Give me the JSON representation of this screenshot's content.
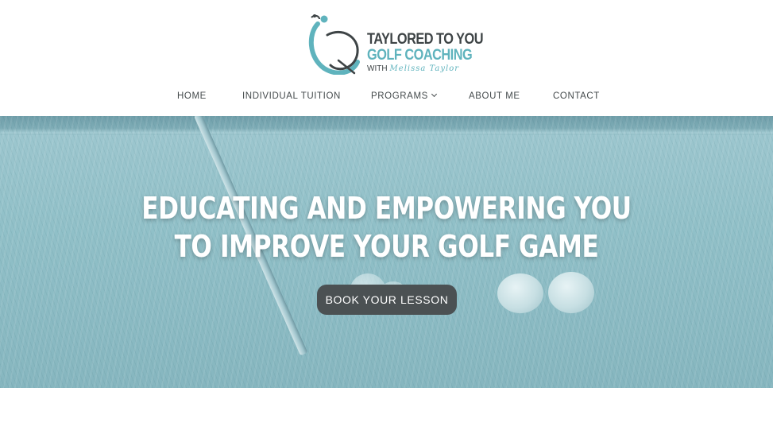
{
  "logo": {
    "line1": "TAYLORED TO YOU",
    "line2": "GOLF COACHING",
    "line3_prefix": "WITH",
    "line3_script": "Melissa Taylor",
    "icon": "golfer-swirl-logo-icon"
  },
  "nav": {
    "items": [
      {
        "label": "HOME"
      },
      {
        "label": "INDIVIDUAL TUITION"
      },
      {
        "label": "PROGRAMS"
      },
      {
        "label": "ABOUT ME"
      },
      {
        "label": "CONTACT"
      }
    ],
    "dropdown_icon": "chevron-down-icon"
  },
  "hero": {
    "title_line1": "EDUCATING AND EMPOWERING YOU",
    "title_line2": "TO IMPROVE YOUR GOLF GAME",
    "cta_label": "BOOK YOUR LESSON"
  },
  "colors": {
    "brand_teal": "#5fb3bd",
    "brand_dark": "#3e4446",
    "button_bg": "#4b5153",
    "hero_overlay": "#91c0c8"
  }
}
